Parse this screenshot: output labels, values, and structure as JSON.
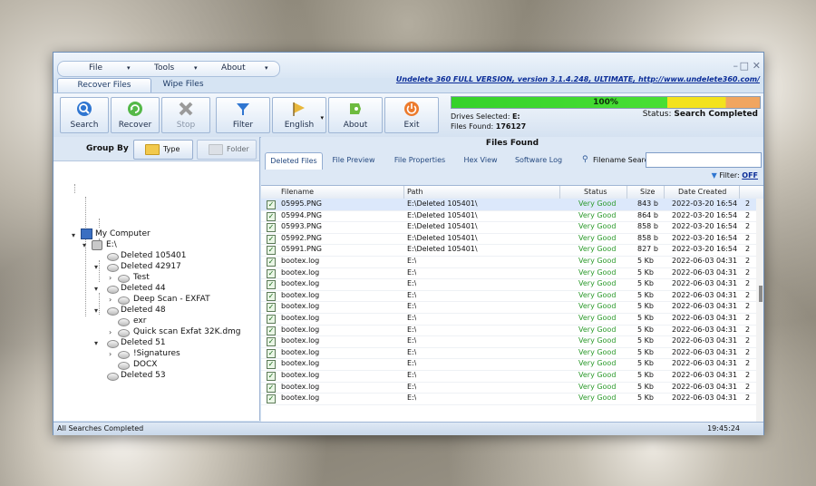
{
  "menu": [
    {
      "label": "File"
    },
    {
      "label": "Tools"
    },
    {
      "label": "About"
    }
  ],
  "tabs": {
    "recover": "Recover Files",
    "wipe": "Wipe Files"
  },
  "version_link": "Undelete 360 FULL VERSION, version 3.1.4.248, ULTIMATE, http://www.undelete360.com/",
  "toolbar": {
    "search": "Search",
    "recover": "Recover",
    "stop": "Stop",
    "filter": "Filter",
    "english": "English",
    "about": "About",
    "exit": "Exit"
  },
  "progress": {
    "percent_text": "100%",
    "percent": 100
  },
  "drives": {
    "label": "Drives Selected:",
    "value": "E:"
  },
  "files_found": {
    "label": "Files Found:",
    "value": "176127"
  },
  "status": {
    "label": "Status:",
    "value": "Search Completed"
  },
  "group_by": {
    "label": "Group By",
    "type": "Type",
    "folder": "Folder"
  },
  "tree": {
    "root": "My Computer",
    "drive": "E:\\",
    "d105401": "Deleted 105401",
    "d42917": "Deleted 42917",
    "test": "Test",
    "d44": "Deleted 44",
    "deepscan": "Deep Scan - EXFAT",
    "d48": "Deleted 48",
    "exr": "exr",
    "quickscan": "Quick scan Exfat 32K.dmg",
    "d51": "Deleted 51",
    "signatures": "!Signatures",
    "docx": "DOCX",
    "d53": "Deleted 53"
  },
  "right": {
    "title": "Files Found",
    "tabs": [
      "Deleted Files",
      "File Preview",
      "File Properties",
      "Hex View",
      "Software Log"
    ],
    "search_label": "Filename Search:",
    "search_value": "",
    "filter_label": "Filter:",
    "filter_value": "OFF"
  },
  "columns": [
    "Filename",
    "Path",
    "Status",
    "Size",
    "Date Created"
  ],
  "rows": [
    {
      "name": "05995.PNG",
      "path": "E:\\Deleted 105401\\",
      "status": "Very Good",
      "size": "843 b",
      "date": "2022-03-20 16:54",
      "extra": "2"
    },
    {
      "name": "05994.PNG",
      "path": "E:\\Deleted 105401\\",
      "status": "Very Good",
      "size": "864 b",
      "date": "2022-03-20 16:54",
      "extra": "2"
    },
    {
      "name": "05993.PNG",
      "path": "E:\\Deleted 105401\\",
      "status": "Very Good",
      "size": "858 b",
      "date": "2022-03-20 16:54",
      "extra": "2"
    },
    {
      "name": "05992.PNG",
      "path": "E:\\Deleted 105401\\",
      "status": "Very Good",
      "size": "858 b",
      "date": "2022-03-20 16:54",
      "extra": "2"
    },
    {
      "name": "05991.PNG",
      "path": "E:\\Deleted 105401\\",
      "status": "Very Good",
      "size": "827 b",
      "date": "2022-03-20 16:54",
      "extra": "2"
    },
    {
      "name": "bootex.log",
      "path": "E:\\",
      "status": "Very Good",
      "size": "5 Kb",
      "date": "2022-06-03 04:31",
      "extra": "2"
    },
    {
      "name": "bootex.log",
      "path": "E:\\",
      "status": "Very Good",
      "size": "5 Kb",
      "date": "2022-06-03 04:31",
      "extra": "2"
    },
    {
      "name": "bootex.log",
      "path": "E:\\",
      "status": "Very Good",
      "size": "5 Kb",
      "date": "2022-06-03 04:31",
      "extra": "2"
    },
    {
      "name": "bootex.log",
      "path": "E:\\",
      "status": "Very Good",
      "size": "5 Kb",
      "date": "2022-06-03 04:31",
      "extra": "2"
    },
    {
      "name": "bootex.log",
      "path": "E:\\",
      "status": "Very Good",
      "size": "5 Kb",
      "date": "2022-06-03 04:31",
      "extra": "2"
    },
    {
      "name": "bootex.log",
      "path": "E:\\",
      "status": "Very Good",
      "size": "5 Kb",
      "date": "2022-06-03 04:31",
      "extra": "2"
    },
    {
      "name": "bootex.log",
      "path": "E:\\",
      "status": "Very Good",
      "size": "5 Kb",
      "date": "2022-06-03 04:31",
      "extra": "2"
    },
    {
      "name": "bootex.log",
      "path": "E:\\",
      "status": "Very Good",
      "size": "5 Kb",
      "date": "2022-06-03 04:31",
      "extra": "2"
    },
    {
      "name": "bootex.log",
      "path": "E:\\",
      "status": "Very Good",
      "size": "5 Kb",
      "date": "2022-06-03 04:31",
      "extra": "2"
    },
    {
      "name": "bootex.log",
      "path": "E:\\",
      "status": "Very Good",
      "size": "5 Kb",
      "date": "2022-06-03 04:31",
      "extra": "2"
    },
    {
      "name": "bootex.log",
      "path": "E:\\",
      "status": "Very Good",
      "size": "5 Kb",
      "date": "2022-06-03 04:31",
      "extra": "2"
    },
    {
      "name": "bootex.log",
      "path": "E:\\",
      "status": "Very Good",
      "size": "5 Kb",
      "date": "2022-06-03 04:31",
      "extra": "2"
    },
    {
      "name": "bootex.log",
      "path": "E:\\",
      "status": "Very Good",
      "size": "5 Kb",
      "date": "2022-06-03 04:31",
      "extra": "2"
    }
  ],
  "statusbar": {
    "left": "All Searches Completed",
    "time": "19:45:24"
  },
  "colors": {
    "accent": "#0a2c98",
    "good": "#2c9a2c",
    "progress_green": "#49df34",
    "progress_yellow": "#f3e21d",
    "progress_orange": "#f0a560"
  }
}
